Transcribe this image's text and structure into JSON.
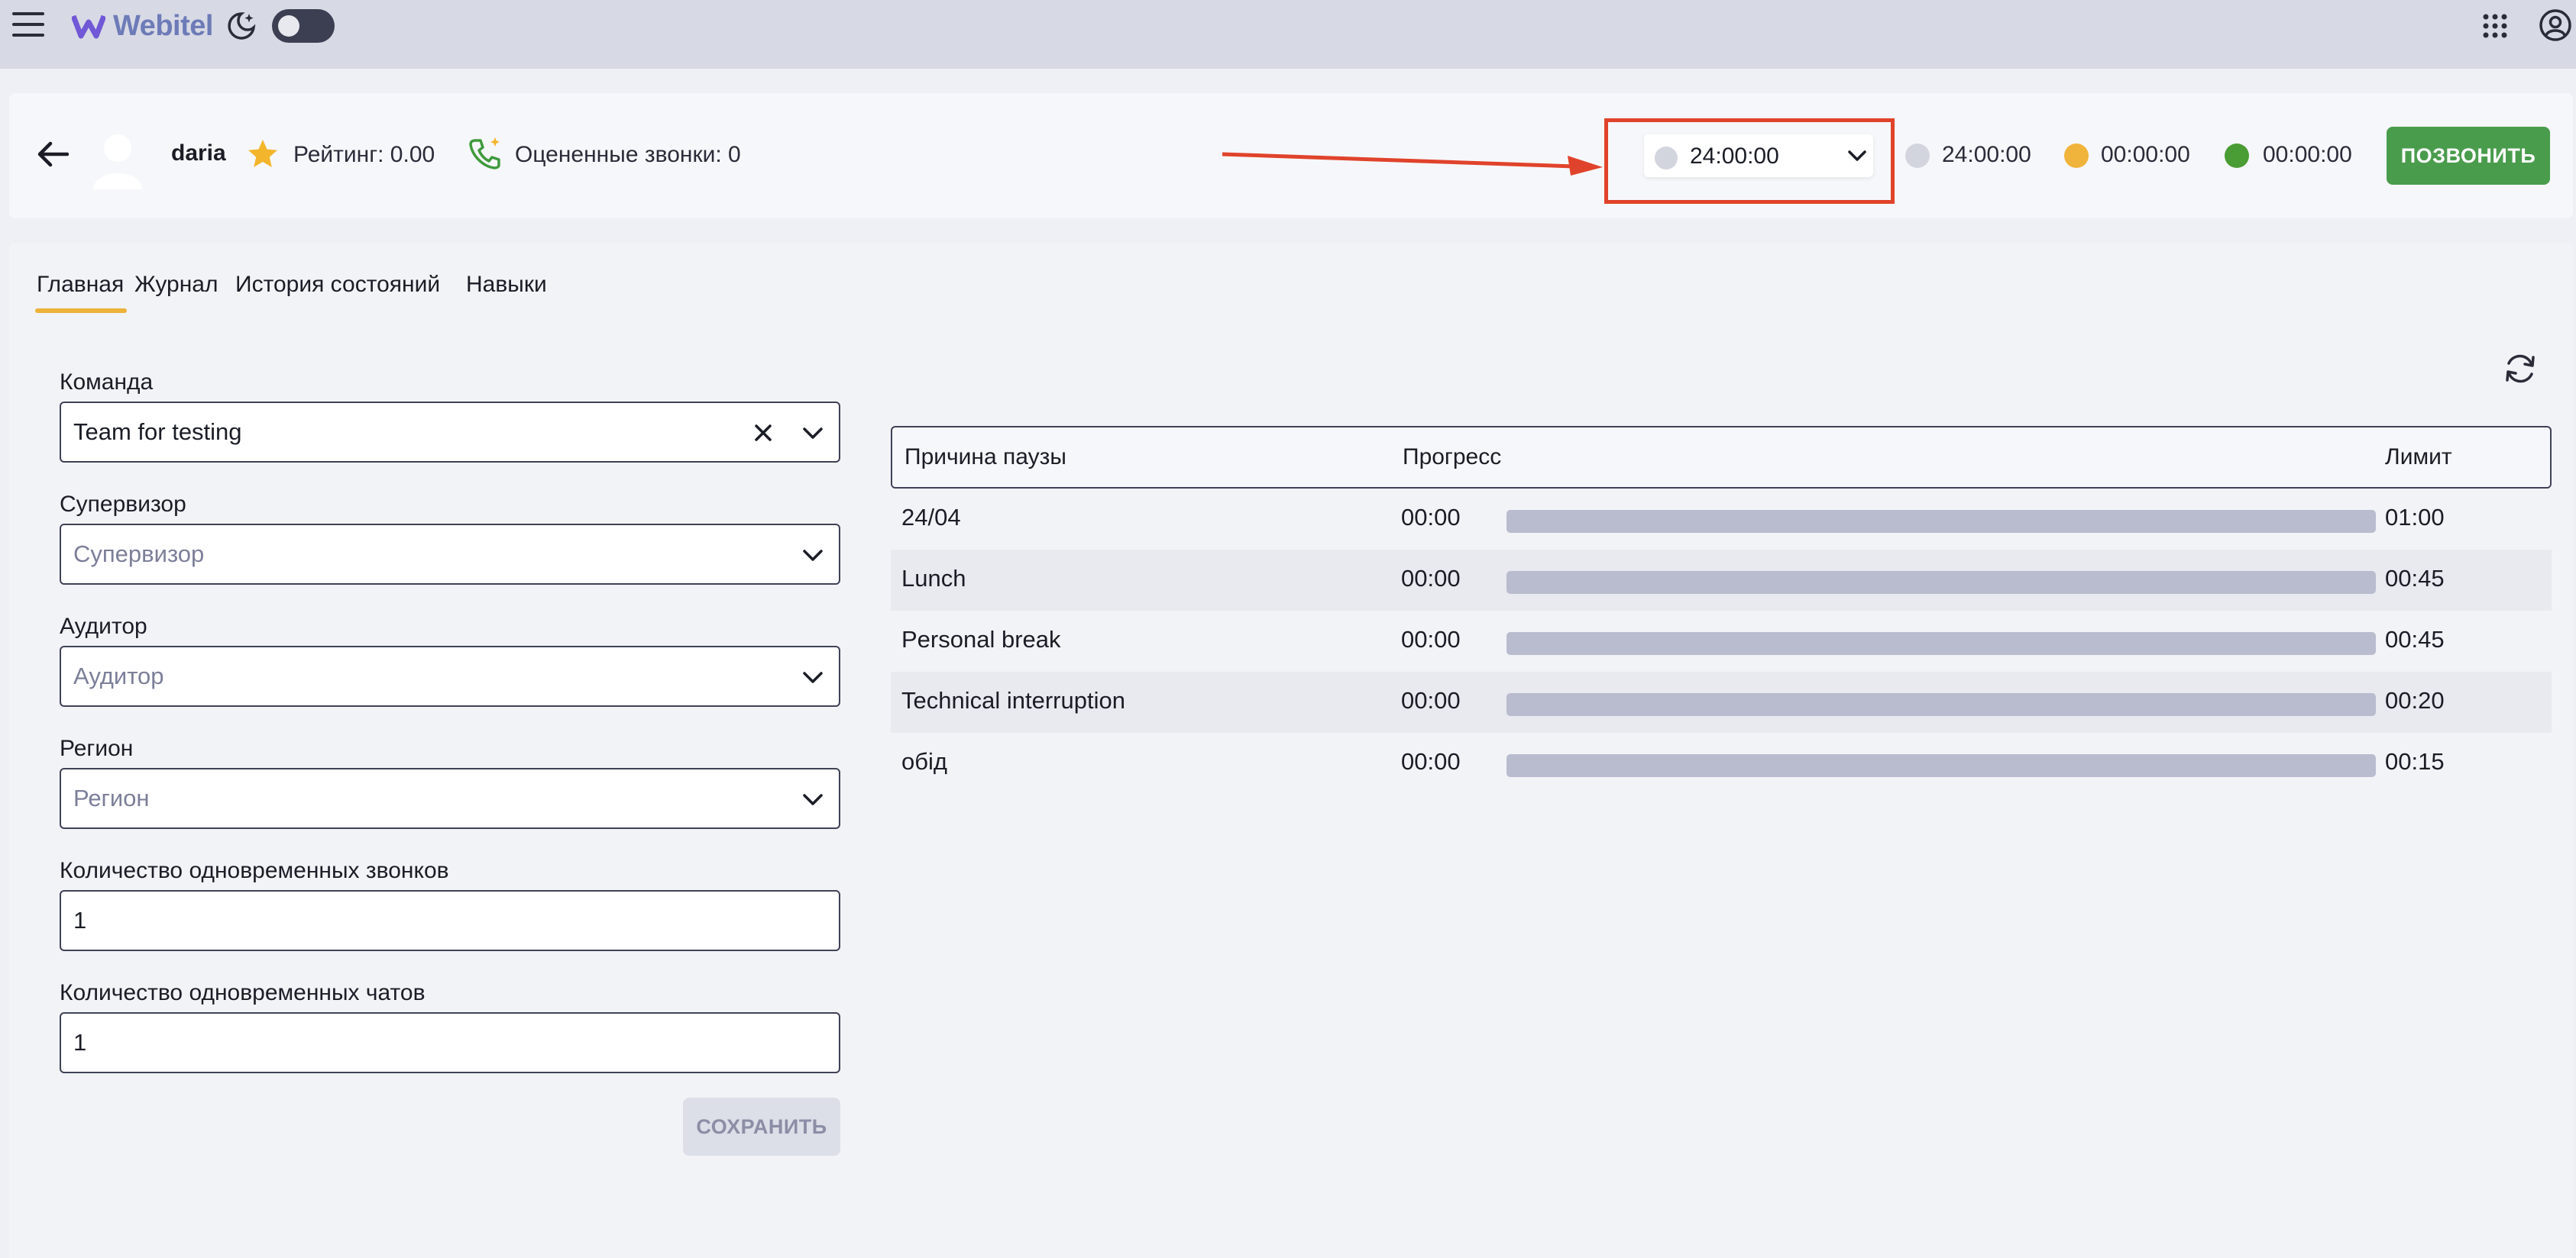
{
  "app": {
    "brand": "Webitel"
  },
  "agent": {
    "name": "daria",
    "rating_text": "Рейтинг: 0.00",
    "rated_calls_text": "Оцененные звонки: 0",
    "status_selected": "24:00:00",
    "counters": [
      {
        "value": "24:00:00",
        "color": "#d3d5de"
      },
      {
        "value": "00:00:00",
        "color": "#f0b43c"
      },
      {
        "value": "00:00:00",
        "color": "#4a9c34"
      }
    ],
    "call_button": "ПОЗВОНИТЬ"
  },
  "tabs": [
    "Главная",
    "Журнал",
    "История состояний",
    "Навыки"
  ],
  "form": {
    "team": {
      "label": "Команда",
      "value": "Team for testing"
    },
    "supervisor": {
      "label": "Супервизор",
      "placeholder": "Супервизор"
    },
    "auditor": {
      "label": "Аудитор",
      "placeholder": "Аудитор"
    },
    "region": {
      "label": "Регион",
      "placeholder": "Регион"
    },
    "concurrent_calls": {
      "label": "Количество одновременных звонков",
      "value": "1"
    },
    "concurrent_chats": {
      "label": "Количество одновременных чатов",
      "value": "1"
    },
    "save_button": "СОХРАНИТЬ"
  },
  "pause_table": {
    "headers": {
      "reason": "Причина паузы",
      "progress": "Прогресс",
      "limit": "Лимит"
    },
    "rows": [
      {
        "reason": "24/04",
        "elapsed": "00:00",
        "progress": 0,
        "limit": "01:00"
      },
      {
        "reason": "Lunch",
        "elapsed": "00:00",
        "progress": 0,
        "limit": "00:45"
      },
      {
        "reason": "Personal break",
        "elapsed": "00:00",
        "progress": 0,
        "limit": "00:45"
      },
      {
        "reason": "Technical interruption",
        "elapsed": "00:00",
        "progress": 0,
        "limit": "00:20"
      },
      {
        "reason": "обід",
        "elapsed": "00:00",
        "progress": 0,
        "limit": "00:15"
      }
    ]
  },
  "colors": {
    "accent_green": "#4a9c4d",
    "tab_underline": "#ecb23a",
    "annotation_red": "#e0432b"
  }
}
